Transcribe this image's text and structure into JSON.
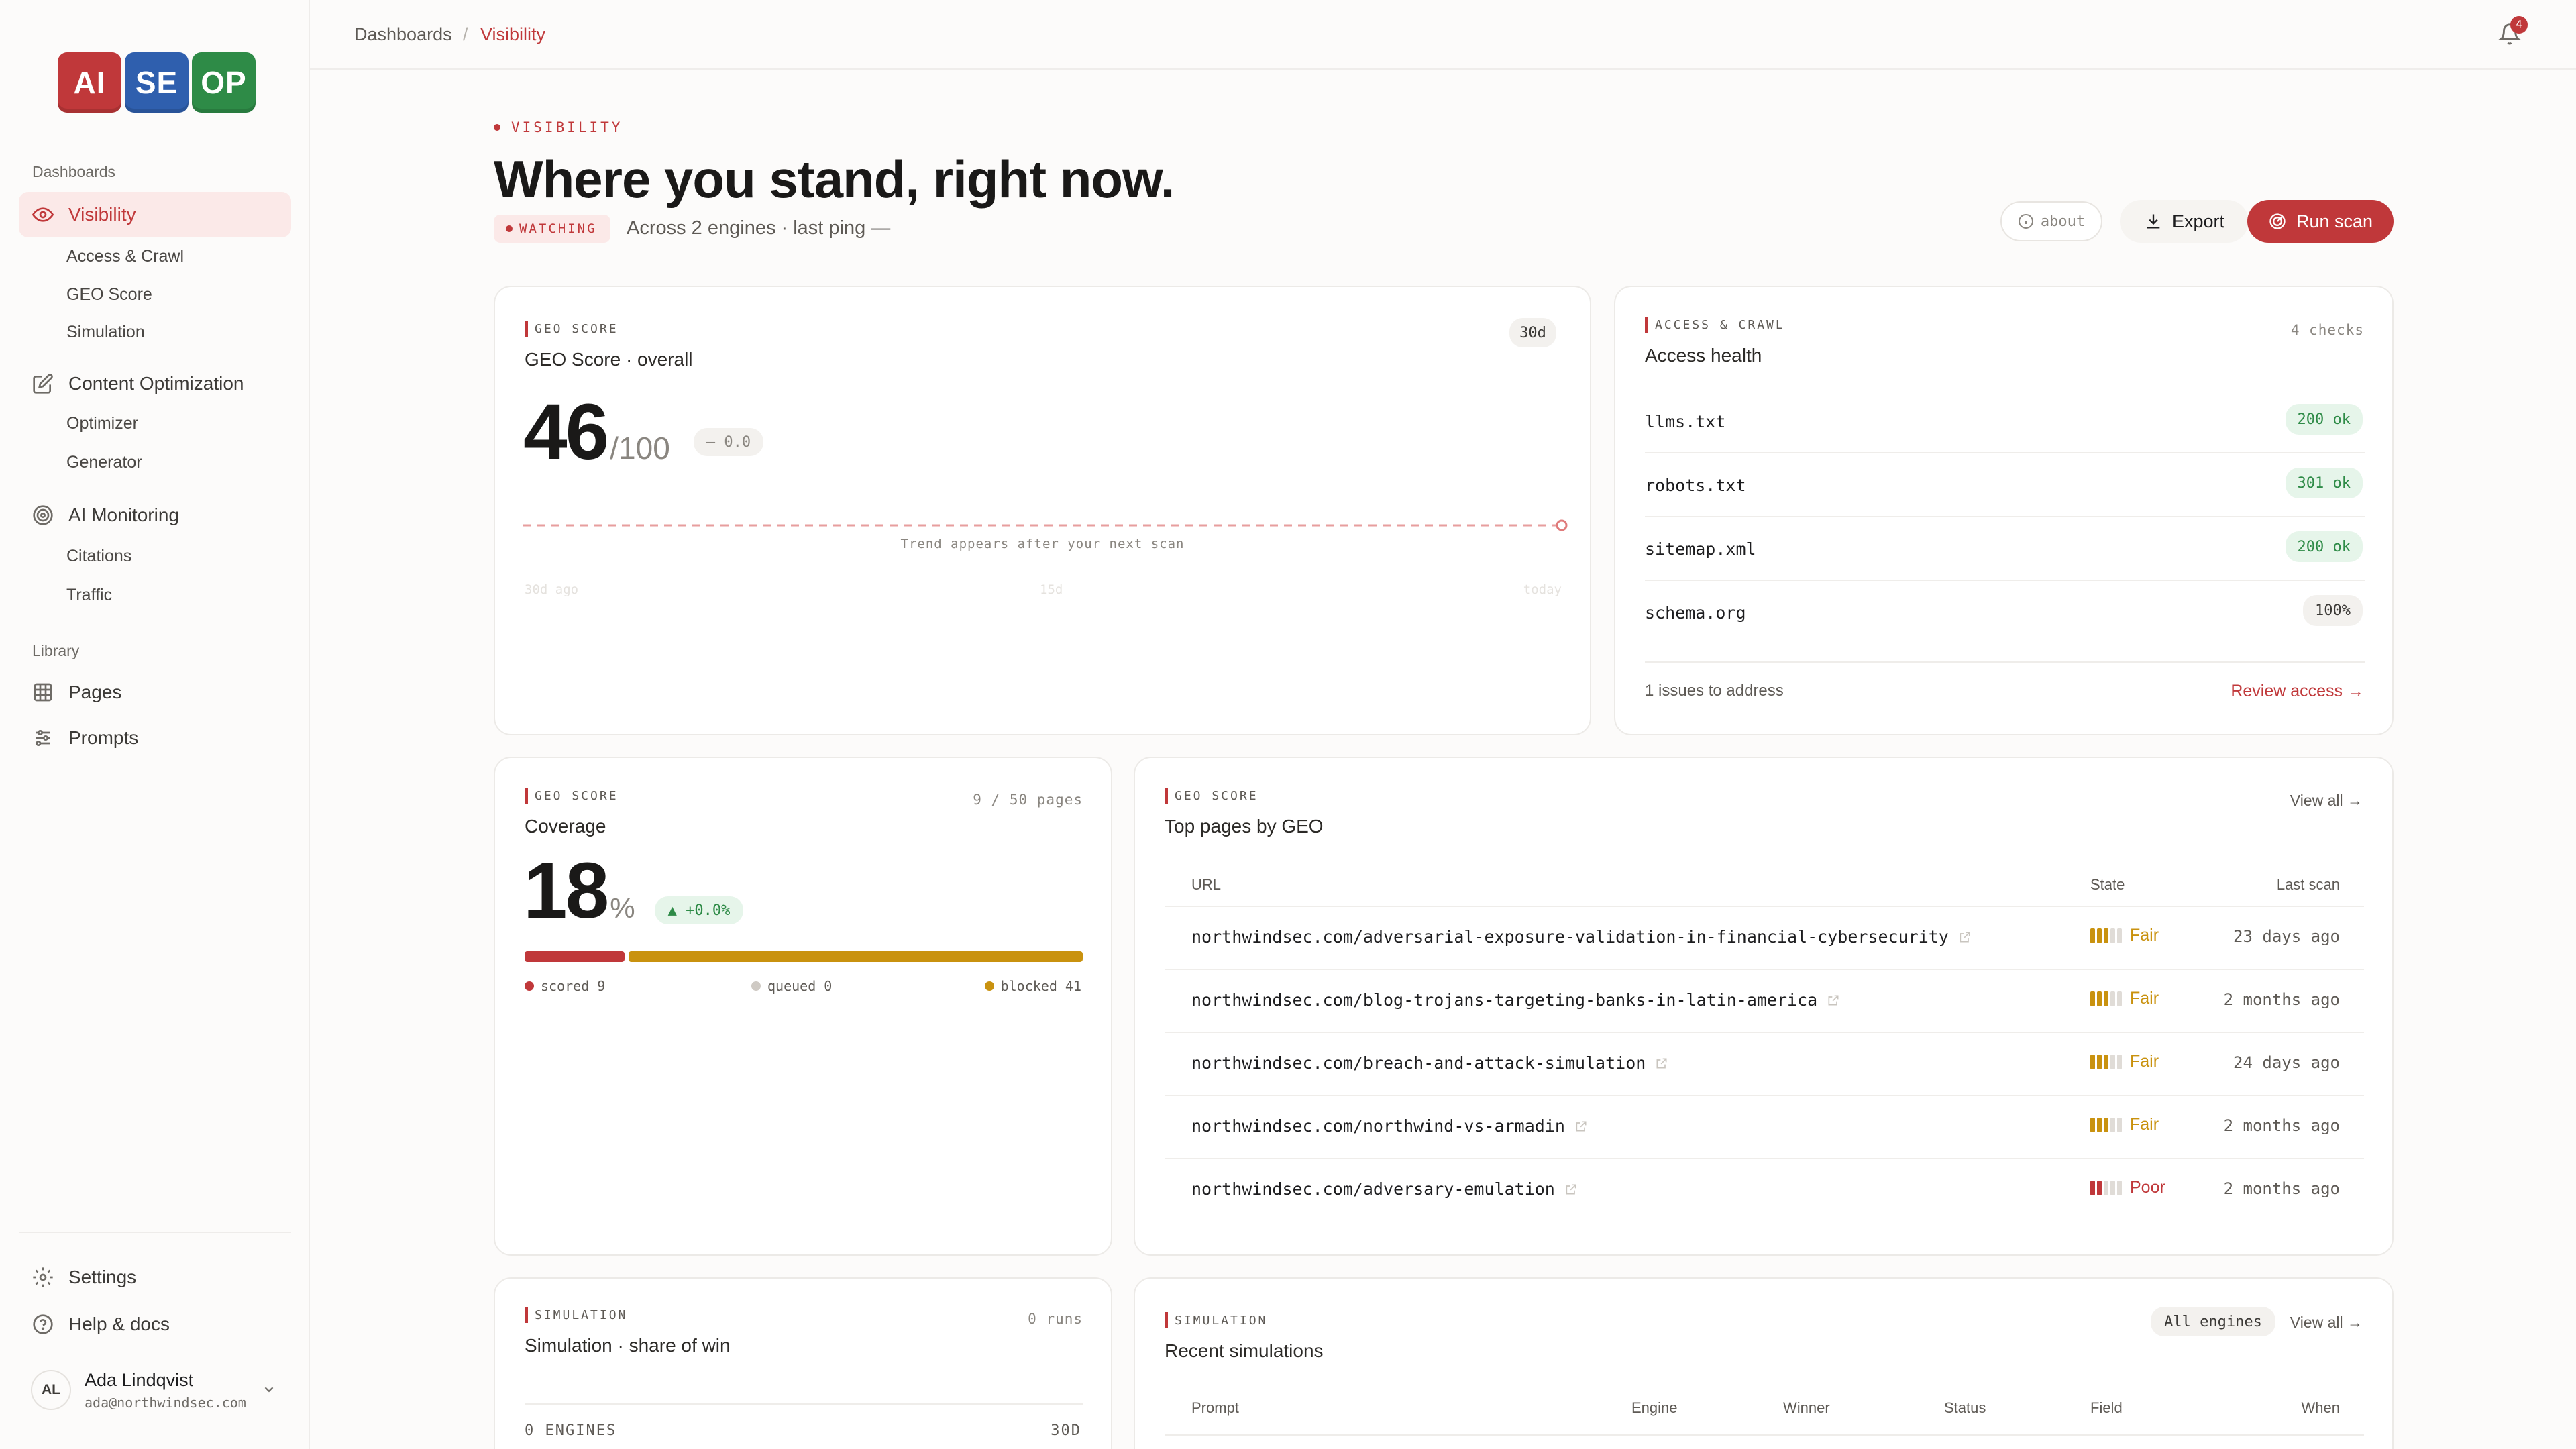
{
  "brand": {
    "tiles": [
      {
        "text": "AI",
        "color": "#c0383a"
      },
      {
        "text": "SE",
        "color": "#2f5fae"
      },
      {
        "text": "OP",
        "color": "#2e8b47"
      }
    ]
  },
  "sidebar": {
    "dashboards_label": "Dashboards",
    "visibility": "Visibility",
    "visibility_sub": [
      "Access & Crawl",
      "GEO Score",
      "Simulation"
    ],
    "content_optimization": "Content Optimization",
    "content_sub": [
      "Optimizer",
      "Generator"
    ],
    "ai_monitoring": "AI Monitoring",
    "monitoring_sub": [
      "Citations",
      "Traffic"
    ],
    "library_label": "Library",
    "pages": "Pages",
    "prompts": "Prompts",
    "settings": "Settings",
    "help": "Help & docs",
    "user": {
      "initials": "AL",
      "name": "Ada Lindqvist",
      "email": "ada@northwindsec.com"
    }
  },
  "header": {
    "crumb_root": "Dashboards",
    "crumb_sep": "/",
    "crumb_current": "Visibility",
    "notifications_count": "4"
  },
  "hero": {
    "eyebrow": "VISIBILITY",
    "title": "Where you stand, right now.",
    "status_badge": "WATCHING",
    "subtitle": "Across 2 engines · last ping —",
    "about_label": "about",
    "export_label": "Export",
    "run_scan_label": "Run scan"
  },
  "geo_card": {
    "tag": "GEO SCORE",
    "title": "GEO Score · overall",
    "range": "30d",
    "score": "46",
    "out_of": "/100",
    "delta": "— 0.0",
    "trend_note": "Trend appears after your next scan",
    "axis": [
      "30d ago",
      "15d",
      "today"
    ]
  },
  "access_card": {
    "tag": "ACCESS & CRAWL",
    "title": "Access health",
    "checks": "4 checks",
    "rows": [
      {
        "name": "llms.txt",
        "status": "200 ok",
        "tone": "ok"
      },
      {
        "name": "robots.txt",
        "status": "301 ok",
        "tone": "ok"
      },
      {
        "name": "sitemap.xml",
        "status": "200 ok",
        "tone": "ok"
      },
      {
        "name": "schema.org",
        "status": "100%",
        "tone": "neutral"
      }
    ],
    "issues": "1 issues to address",
    "review_link": "Review access →"
  },
  "coverage_card": {
    "tag": "GEO SCORE",
    "title": "Coverage",
    "pages": "9 / 50 pages",
    "value": "18",
    "unit": "%",
    "delta": "▲ +0.0%",
    "scored": 9,
    "queued": 0,
    "blocked": 41,
    "total": 50,
    "scored_label": "scored 9",
    "queued_label": "queued 0",
    "blocked_label": "blocked 41",
    "colors": {
      "scored": "#c0383a",
      "queued": "#cfcac4",
      "blocked": "#c9920f"
    }
  },
  "top_pages": {
    "tag": "GEO SCORE",
    "title": "Top pages by GEO",
    "view_all": "View all →",
    "columns": {
      "url": "URL",
      "state": "State",
      "last_scan": "Last scan"
    },
    "rows": [
      {
        "url": "northwindsec.com/adversarial-exposure-validation-in-financial-cybersecurity",
        "state": "Fair",
        "level": 3,
        "last": "23 days ago"
      },
      {
        "url": "northwindsec.com/blog-trojans-targeting-banks-in-latin-america",
        "state": "Fair",
        "level": 3,
        "last": "2 months ago"
      },
      {
        "url": "northwindsec.com/breach-and-attack-simulation",
        "state": "Fair",
        "level": 3,
        "last": "24 days ago"
      },
      {
        "url": "northwindsec.com/northwind-vs-armadin",
        "state": "Fair",
        "level": 3,
        "last": "2 months ago"
      },
      {
        "url": "northwindsec.com/adversary-emulation",
        "state": "Poor",
        "level": 2,
        "last": "2 months ago"
      }
    ]
  },
  "sim_card": {
    "tag": "SIMULATION",
    "title": "Simulation · share of win",
    "runs": "0 runs",
    "engines_label": "0 ENGINES",
    "range": "30D"
  },
  "recent_sim": {
    "tag": "SIMULATION",
    "title": "Recent simulations",
    "filter": "All engines",
    "view_all": "View all →",
    "columns": [
      "Prompt",
      "Engine",
      "Winner",
      "Status",
      "Field",
      "When"
    ]
  }
}
